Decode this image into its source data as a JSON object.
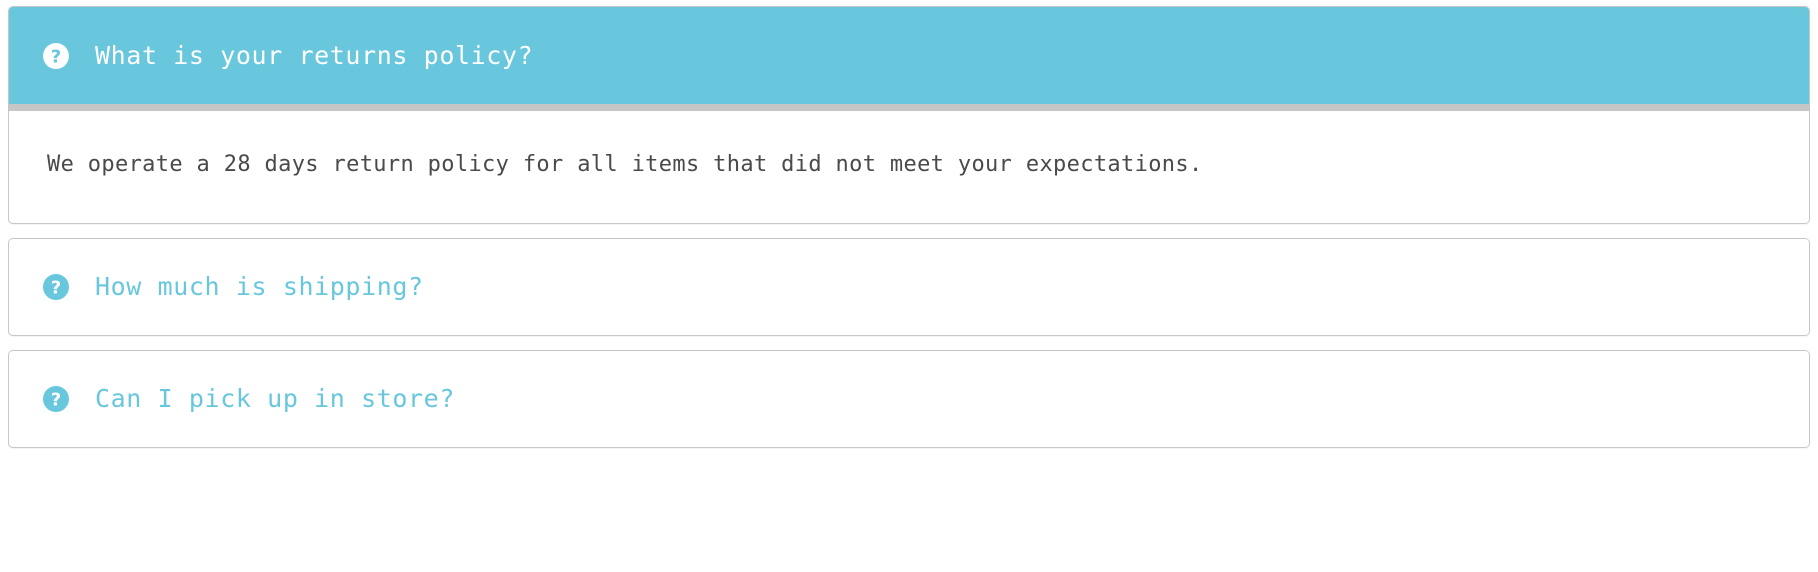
{
  "accent_color": "#68c7dd",
  "border_color": "#c6c6c6",
  "body_text_color": "#4a4a4a",
  "faq": {
    "items": [
      {
        "icon": "question-circle-icon",
        "question": "What is your returns policy?",
        "answer": "We operate a 28 days return policy for all items that did not meet your expectations.",
        "state": "expanded"
      },
      {
        "icon": "question-circle-icon",
        "question": "How much is shipping?",
        "answer": "",
        "state": "collapsed"
      },
      {
        "icon": "question-circle-icon",
        "question": "Can I pick up in store?",
        "answer": "",
        "state": "collapsed"
      }
    ]
  }
}
